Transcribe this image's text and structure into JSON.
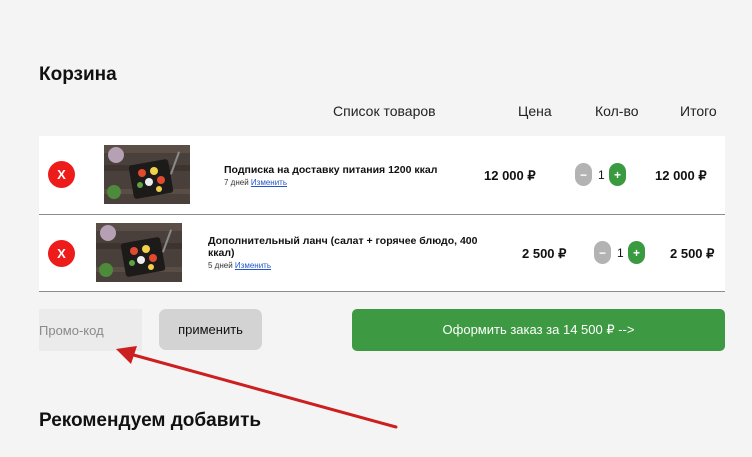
{
  "cart": {
    "title": "Корзина",
    "headers": {
      "items": "Список товаров",
      "price": "Цена",
      "qty": "Кол-во",
      "total": "Итого"
    },
    "items": [
      {
        "remove_label": "X",
        "name": "Подписка на доставку питания 1200 ккал",
        "days": "7 дней",
        "change_label": "Изменить",
        "price": "12 000 ₽",
        "minus_label": "−",
        "quantity": "1",
        "plus_label": "+",
        "total": "12 000 ₽"
      },
      {
        "remove_label": "X",
        "name": "Дополнительный ланч (салат + горячее блюдо, 400 ккал)",
        "days": "5 дней",
        "change_label": "Изменить",
        "price": "2 500 ₽",
        "minus_label": "−",
        "quantity": "1",
        "plus_label": "+",
        "total": "2 500 ₽"
      }
    ]
  },
  "promo": {
    "placeholder": "Промо-код",
    "apply_label": "применить"
  },
  "checkout": {
    "label": "Оформить заказ за 14 500 ₽ -->"
  },
  "recommend": {
    "title": "Рекомендуем добавить"
  },
  "colors": {
    "remove": "#ee1b1b",
    "accent_green": "#3d9a43",
    "annotation_arrow": "#cc1f1f"
  }
}
